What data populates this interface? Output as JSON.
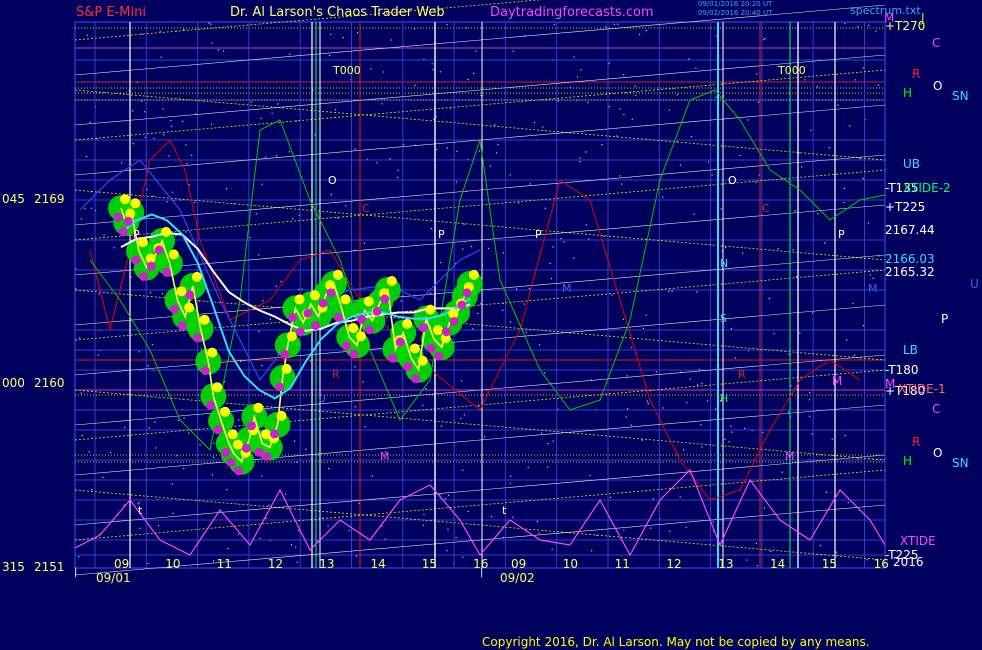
{
  "header": {
    "instrument": "S&P E-Mini",
    "author": "Dr. Al Larson's Chaos Trader Web",
    "site": "Daytradingforecasts.com",
    "stamp1": "09/01/2016 20:20 UT",
    "stamp2": "09/02/2016 20:40 UT",
    "brand": "spectrum.txt"
  },
  "footer": {
    "copyright": "Copyright 2016, Dr. Al Larson. May not be copied by any means."
  },
  "colors": {
    "background": "#00005e",
    "price": "#ffff66",
    "bands": "#00d800",
    "xtide": "#ff44ff",
    "rline": "#e00000",
    "gline": "#00c800",
    "cyanline": "#33ddff",
    "whiteavg": "#ffffff"
  },
  "chart_data": {
    "type": "line",
    "title": "S&P E-Mini",
    "dates": [
      "09/01",
      "09/02"
    ],
    "x_tick_labels": [
      "09",
      "10",
      "11",
      "12",
      "13",
      "14",
      "15",
      "16",
      "09",
      "10",
      "11",
      "12",
      "13",
      "14",
      "15",
      "16"
    ],
    "y_left_ticks": [
      {
        "a": "045",
        "b": "2169",
        "value": 2169
      },
      {
        "a": "000",
        "b": "2160",
        "value": 2160
      },
      {
        "a": "315",
        "b": "2151",
        "value": 2151
      }
    ],
    "ylim": [
      2151,
      2169
    ],
    "right_price_labels": [
      "2167.44",
      "2166.03",
      "2165.32"
    ],
    "right_labels": [
      "+T270",
      "+T225",
      "-T135",
      "-T180",
      "+T180",
      "-T225",
      "2016",
      "XTIDE",
      "XTIDE-2",
      "XTIDE-1",
      "UB",
      "LB",
      "U",
      "P",
      "M",
      "C",
      "R",
      "H",
      "O",
      "SN",
      "J"
    ],
    "markers_inside": [
      "T000",
      "T000",
      "O",
      "O",
      "C",
      "C",
      "P",
      "P",
      "P",
      "P",
      "R",
      "R",
      "M",
      "M",
      "M",
      "M",
      "N",
      "S",
      "H",
      "t",
      "t",
      "U"
    ],
    "series": [
      {
        "name": "price",
        "x": [
          9.0,
          9.1,
          9.2,
          9.35,
          9.5,
          9.65,
          9.8,
          9.95,
          10.1,
          10.25,
          10.4,
          10.55,
          10.7,
          10.8,
          10.95,
          11.1,
          11.2,
          11.35,
          11.5,
          11.6,
          11.75,
          11.9,
          12.05,
          12.15,
          12.25,
          12.4,
          12.55,
          12.7,
          12.85,
          13.0,
          13.15,
          13.3,
          13.45,
          13.6,
          13.75,
          13.9,
          14.05,
          14.2,
          14.35,
          14.5,
          14.65,
          14.8,
          14.95,
          15.1,
          15.25,
          15.4,
          15.55,
          15.7,
          15.8
        ],
        "y": [
          2168.5,
          2167.8,
          2168.3,
          2166.4,
          2165.6,
          2166.1,
          2166.9,
          2165.8,
          2164.0,
          2163.2,
          2164.7,
          2162.6,
          2161.0,
          2159.3,
          2158.1,
          2157.0,
          2156.5,
          2156.1,
          2157.2,
          2158.3,
          2157.0,
          2156.8,
          2157.9,
          2160.2,
          2161.8,
          2163.6,
          2162.9,
          2163.8,
          2163.2,
          2164.3,
          2164.8,
          2163.6,
          2162.2,
          2161.8,
          2163.5,
          2163.0,
          2163.9,
          2164.5,
          2161.6,
          2162.4,
          2161.2,
          2160.6,
          2163.1,
          2162.1,
          2161.7,
          2162.9,
          2163.4,
          2164.2,
          2164.8
        ]
      },
      {
        "name": "white-average",
        "x": [
          9.0,
          9.3,
          9.6,
          9.9,
          10.2,
          10.5,
          10.8,
          11.1,
          11.4,
          11.7,
          12.0,
          12.3,
          12.6,
          12.9,
          13.2,
          13.5,
          13.8,
          14.1,
          14.4,
          14.7,
          15.0,
          15.3,
          15.6,
          15.8
        ],
        "y": [
          2166.6,
          2167.0,
          2167.1,
          2167.3,
          2167.2,
          2166.5,
          2165.4,
          2164.4,
          2163.9,
          2163.5,
          2163.2,
          2162.8,
          2162.5,
          2162.6,
          2162.9,
          2163.0,
          2163.2,
          2163.3,
          2163.4,
          2163.4,
          2163.6,
          2163.6,
          2163.6,
          2163.8
        ]
      },
      {
        "name": "cyan-average",
        "x": [
          9.0,
          9.3,
          9.6,
          9.9,
          10.2,
          10.5,
          10.8,
          11.1,
          11.4,
          11.7,
          12.0,
          12.3,
          12.6,
          12.9,
          13.2,
          13.5,
          13.8,
          14.1,
          14.4,
          14.7,
          15.0,
          15.3,
          15.6,
          15.8
        ],
        "y": [
          2167.3,
          2167.9,
          2168.2,
          2167.9,
          2167.2,
          2165.8,
          2163.7,
          2161.5,
          2160.3,
          2159.6,
          2159.2,
          2159.7,
          2161.0,
          2162.1,
          2162.8,
          2163.2,
          2163.4,
          2163.4,
          2163.2,
          2163.1,
          2163.1,
          2163.3,
          2163.7,
          2164.1
        ]
      }
    ],
    "grid": true,
    "legend": "none"
  }
}
